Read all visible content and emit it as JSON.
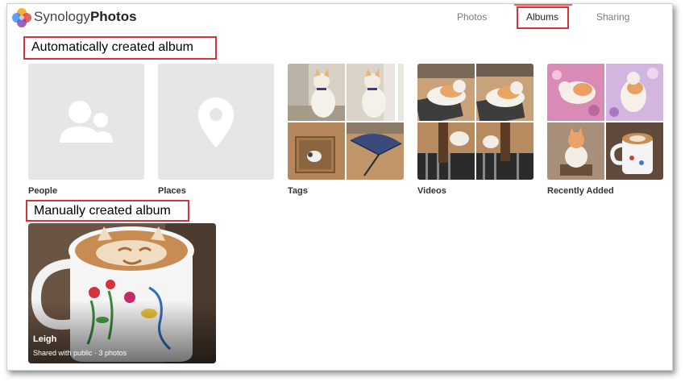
{
  "header": {
    "brand_plain": "Synology",
    "brand_bold": "Photos",
    "nav": [
      {
        "label": "Photos",
        "active": false
      },
      {
        "label": "Albums",
        "active": true
      },
      {
        "label": "Sharing",
        "active": false
      }
    ]
  },
  "callouts": {
    "auto": "Automatically created album",
    "manual": "Manually created album"
  },
  "auto_albums": [
    {
      "label": "People",
      "icon": "people-icon"
    },
    {
      "label": "Places",
      "icon": "map-pin-icon"
    },
    {
      "label": "Tags"
    },
    {
      "label": "Videos"
    },
    {
      "label": "Recently Added"
    }
  ],
  "manual_album": {
    "title": "Leigh",
    "subtitle": "Shared with public · 3 photos"
  },
  "colors": {
    "accent": "#e8645a",
    "callout_border": "#d8323a",
    "placeholder": "#e6e6e6"
  }
}
